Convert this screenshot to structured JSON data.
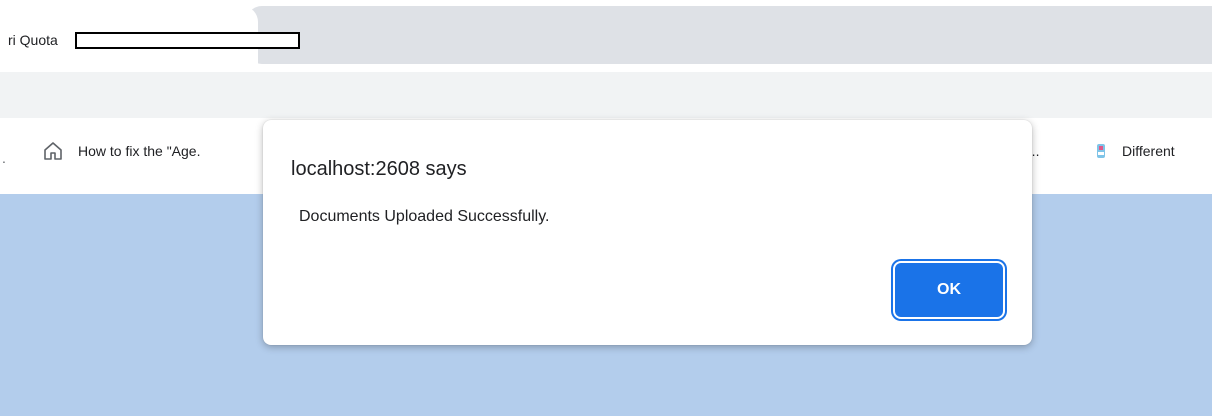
{
  "tabs": {
    "active_title": "ri Quota"
  },
  "bookmarks": {
    "item_left_fragment": ".",
    "item_house_label": "How to fix the \"Age.",
    "item_right1_label": "o...",
    "item_right2_label": "Different"
  },
  "dialog": {
    "title": "localhost:2608 says",
    "message": "Documents Uploaded Successfully.",
    "ok_label": "OK"
  },
  "colors": {
    "accent": "#1a73e8",
    "page_background": "#b3cdec",
    "tabstrip_inactive": "#dee1e6"
  },
  "icons": {
    "house": "home-icon",
    "bookmark_favicon": "favicon-icon"
  }
}
